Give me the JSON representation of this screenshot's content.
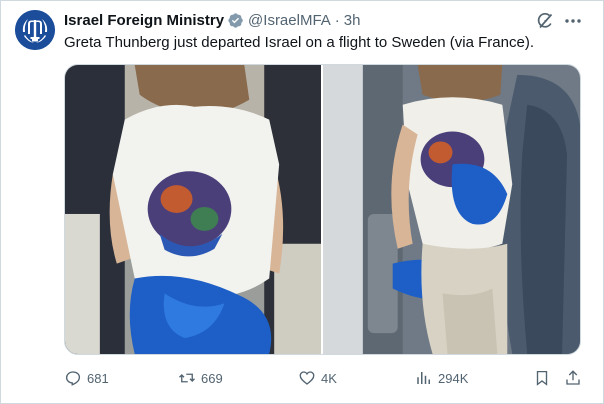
{
  "tweet": {
    "author_name": "Israel Foreign Ministry",
    "handle": "@IsraelMFA",
    "separator": "·",
    "time": "3h",
    "text": "Greta Thunberg just departed Israel on a flight to Sweden (via France).",
    "verified": true
  },
  "media": {
    "count": 2
  },
  "actions": {
    "replies": "681",
    "reposts": "669",
    "likes": "4K",
    "views": "294K"
  },
  "colors": {
    "text": "#0f1419",
    "secondary": "#536471",
    "verified_badge": "#829aab",
    "border": "#cfd9de",
    "avatar_bg": "#1b4d9b"
  },
  "icons": {
    "avatar": "israel-emblem-icon",
    "verified": "verified-badge-icon",
    "grok": "grok-icon",
    "more": "more-icon",
    "reply": "reply-icon",
    "repost": "repost-icon",
    "like": "heart-icon",
    "views": "views-icon",
    "bookmark": "bookmark-icon",
    "share": "share-icon"
  }
}
